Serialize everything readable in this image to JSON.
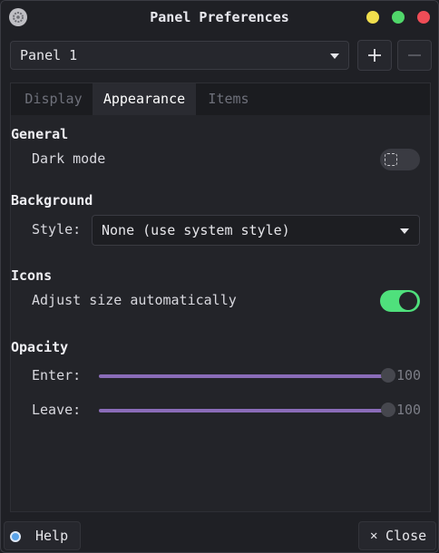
{
  "window": {
    "title": "Panel Preferences"
  },
  "panel_selector": {
    "value": "Panel 1",
    "add_label": "+",
    "remove_label": "−"
  },
  "tabs": [
    {
      "label": "Display",
      "active": false
    },
    {
      "label": "Appearance",
      "active": true
    },
    {
      "label": "Items",
      "active": false
    }
  ],
  "general": {
    "heading": "General",
    "dark_mode_label": "Dark mode",
    "dark_mode_on": false
  },
  "background": {
    "heading": "Background",
    "style_label": "Style:",
    "style_value": "None (use system style)"
  },
  "icons": {
    "heading": "Icons",
    "adjust_label": "Adjust size automatically",
    "adjust_on": true
  },
  "opacity": {
    "heading": "Opacity",
    "enter_label": "Enter:",
    "enter_value": "100",
    "leave_label": "Leave:",
    "leave_value": "100"
  },
  "footer": {
    "help_label": "Help",
    "close_label": "Close"
  },
  "colors": {
    "accent_slider": "#8a6cb8",
    "toggle_on": "#4fe07c"
  }
}
